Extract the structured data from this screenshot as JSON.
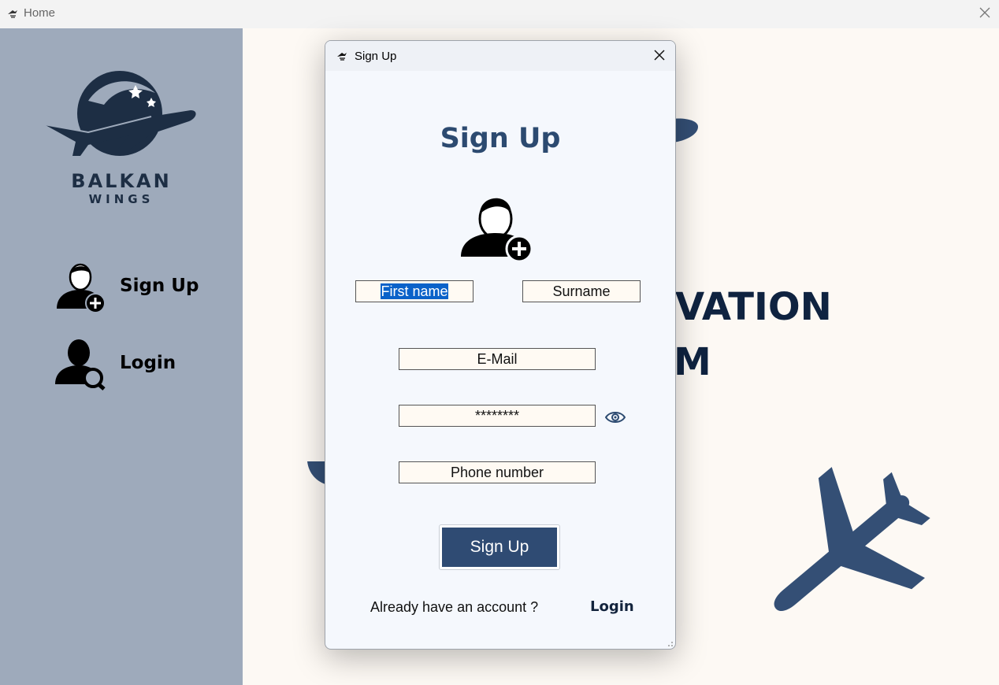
{
  "main_window": {
    "title": "Home"
  },
  "logo": {
    "line1": "BALKAN",
    "line2": "WINGS"
  },
  "sidebar": {
    "items": [
      {
        "label": "Sign Up",
        "icon": "add-user-icon"
      },
      {
        "label": "Login",
        "icon": "user-search-icon"
      }
    ]
  },
  "background": {
    "line1": "RVATION",
    "line2": "M"
  },
  "dialog": {
    "title": "Sign Up",
    "heading": "Sign Up",
    "fields": {
      "first_name": "First name",
      "surname": "Surname",
      "email": "E-Mail",
      "password": "********",
      "phone": "Phone number"
    },
    "submit_label": "Sign Up",
    "footer_text": "Already have an account ?",
    "login_link": "Login"
  },
  "colors": {
    "accent": "#2f4b73",
    "sidebar": "#9eaabb",
    "heading": "#2c4a70",
    "plane": "#344f75"
  }
}
